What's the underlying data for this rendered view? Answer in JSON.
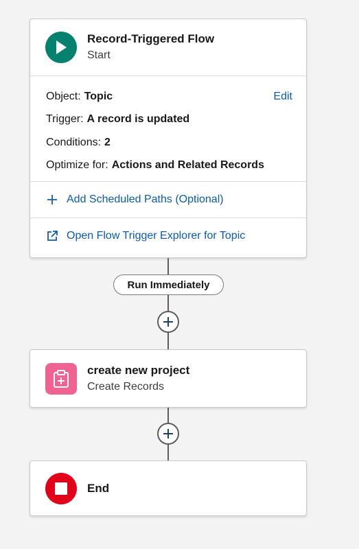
{
  "start_node": {
    "title": "Record-Triggered Flow",
    "subtitle": "Start",
    "icon": "play-icon",
    "icon_color": "#05826f",
    "details": [
      {
        "label": "Object:",
        "value": "Topic"
      },
      {
        "label": "Trigger:",
        "value": "A record is updated"
      },
      {
        "label": "Conditions:",
        "value": "2"
      },
      {
        "label": "Optimize for:",
        "value": "Actions and Related Records"
      }
    ],
    "edit_label": "Edit",
    "add_paths_label": "Add Scheduled Paths (Optional)",
    "explorer_label": "Open Flow Trigger Explorer for Topic"
  },
  "path_label": "Run Immediately",
  "create_node": {
    "title": "create new project",
    "subtitle": "Create Records",
    "icon": "create-records-icon",
    "icon_color": "#f06292"
  },
  "end_node": {
    "title": "End",
    "icon": "stop-icon",
    "icon_color": "#e3001b"
  },
  "colors": {
    "link": "#0b5cab",
    "connector": "#5c5c5c"
  }
}
